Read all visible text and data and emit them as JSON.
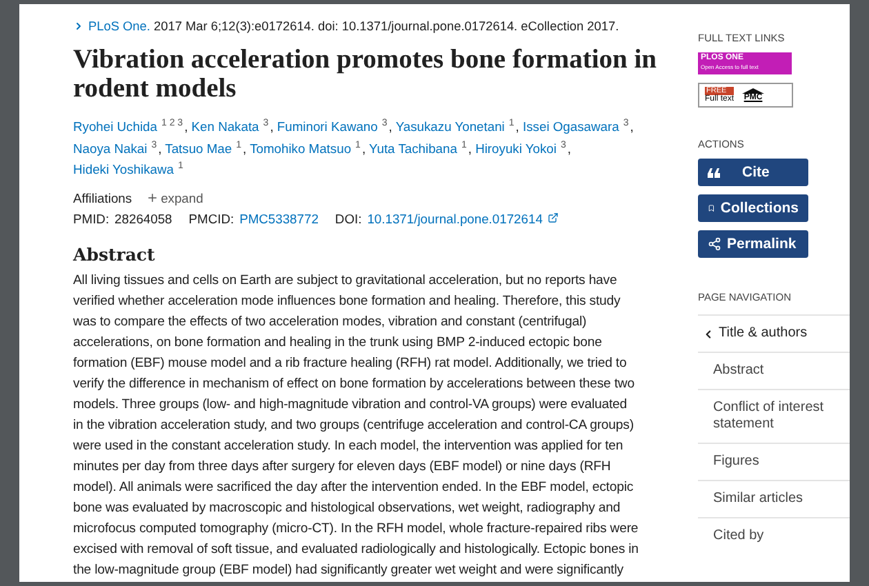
{
  "citation": {
    "journal": "PLoS One.",
    "details": "2017 Mar 6;12(3):e0172614. doi: 10.1371/journal.pone.0172614. eCollection 2017."
  },
  "title": "Vibration acceleration promotes bone formation in rodent models",
  "authors": [
    {
      "name": "Ryohei Uchida",
      "refs": "1 2 3",
      "sep": ","
    },
    {
      "name": "Ken Nakata",
      "refs": "3",
      "sep": ","
    },
    {
      "name": "Fuminori Kawano",
      "refs": "3",
      "sep": ","
    },
    {
      "name": "Yasukazu Yonetani",
      "refs": "1",
      "sep": ","
    },
    {
      "name": "Issei Ogasawara",
      "refs": "3",
      "sep": ","
    },
    {
      "name": "Naoya Nakai",
      "refs": "3",
      "sep": ","
    },
    {
      "name": "Tatsuo Mae",
      "refs": "1",
      "sep": ","
    },
    {
      "name": "Tomohiko Matsuo",
      "refs": "1",
      "sep": ","
    },
    {
      "name": "Yuta Tachibana",
      "refs": "1",
      "sep": ","
    },
    {
      "name": "Hiroyuki Yokoi",
      "refs": "3",
      "sep": ","
    },
    {
      "name": "Hideki Yoshikawa",
      "refs": "1"
    }
  ],
  "affiliations": {
    "label": "Affiliations",
    "toggle": "expand",
    "expanded": false
  },
  "ids": [
    {
      "label": "PMID:",
      "value": "28264058",
      "link": false
    },
    {
      "label": "PMCID:",
      "value": "PMC5338772",
      "link": true
    },
    {
      "label": "DOI:",
      "value": "10.1371/journal.pone.0172614",
      "link": true
    }
  ],
  "abstract": {
    "heading": "Abstract",
    "lines": [
      "All living tissues and cells on Earth are subject to gravitational acceleration, but no reports have",
      "verified whether acceleration mode influences bone formation and healing. Therefore, this study",
      "was to compare the effects of two acceleration modes, vibration and constant (centrifugal)",
      "accelerations, on bone formation and healing in the trunk using BMP 2-induced ectopic bone",
      "formation (EBF) mouse model and a rib fracture healing (RFH) rat model. Additionally, we tried to",
      "verify the difference in mechanism of effect on bone formation by accelerations between these two",
      "models. Three groups (low- and high-magnitude vibration and control-VA groups) were evaluated",
      "in the vibration acceleration study, and two groups (centrifuge acceleration and control-CA groups)",
      "were used in the constant acceleration study. In each model, the intervention was applied for ten",
      "minutes per day from three days after surgery for eleven days (EBF model) or nine days (RFH",
      "model). All animals were sacrificed the day after the intervention ended. In the EBF model, ectopic",
      "bone was evaluated by macroscopic and histological observations, wet weight, radiography and",
      "microfocus computed tomography (micro-CT). In the RFH model, whole fracture-repaired ribs were",
      "excised with removal of soft tissue, and evaluated radiologically and histologically. Ectopic bones in",
      "the low-magnitude group (EBF model) had significantly greater wet weight and were significantly"
    ]
  },
  "sidebar": {
    "full_text_heading": "FULL TEXT LINKS",
    "plos_badge": {
      "name": "PLOS ONE",
      "tagline": "Open Access to full text"
    },
    "pmc_badge": {
      "free": "FREE",
      "full_text": "Full text",
      "name": "PMC"
    },
    "actions_heading": "ACTIONS",
    "actions": [
      {
        "kind": "cite",
        "label": "Cite"
      },
      {
        "kind": "collections",
        "label": "Collections"
      },
      {
        "kind": "permalink",
        "label": "Permalink"
      }
    ],
    "nav_heading": "PAGE NAVIGATION",
    "nav": [
      {
        "label": "Title & authors",
        "selected": true
      },
      {
        "label": "Abstract",
        "selected": false
      },
      {
        "label": "Conflict of interest statement",
        "selected": false
      },
      {
        "label": "Figures",
        "selected": false
      },
      {
        "label": "Similar articles",
        "selected": false
      },
      {
        "label": "Cited by",
        "selected": false
      }
    ]
  }
}
